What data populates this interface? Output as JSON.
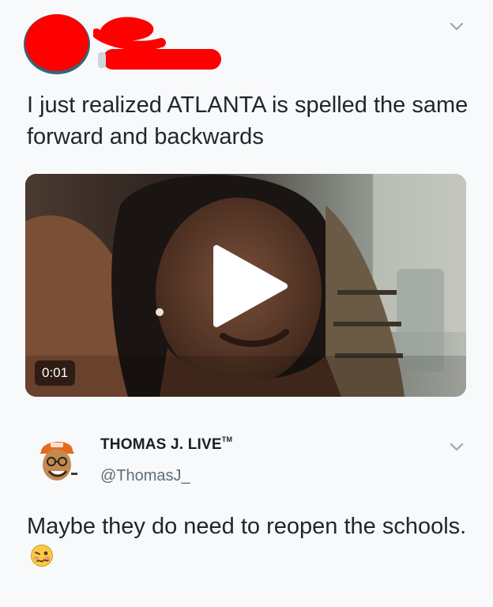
{
  "tweet": {
    "text": "I just realized ATLANTA is spelled the same forward and backwards",
    "media": {
      "duration": "0:01"
    }
  },
  "reply": {
    "author_name": "THOMAS J. LIVE",
    "author_mark": "TM",
    "handle": "@ThomasJ_",
    "text": "Maybe they do need to reopen the schools.",
    "emoji": "woozy-face-icon"
  },
  "colors": {
    "background": "#f7f9fa",
    "redaction": "#ff0000",
    "chevron": "#9aa8b4",
    "handle": "#5f6e7a"
  }
}
